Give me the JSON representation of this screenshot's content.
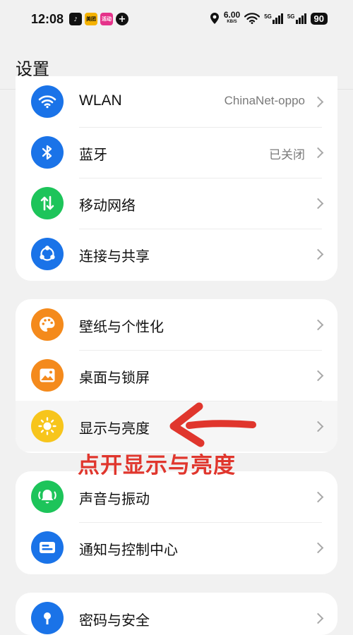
{
  "status_bar": {
    "time": "12:08",
    "app_icons": [
      {
        "name": "tiktok-icon",
        "text": "♪",
        "color": "#111111"
      },
      {
        "name": "meituan-icon",
        "text": "美团",
        "color": "#f5b200"
      },
      {
        "name": "shopping-app-icon",
        "text": "活动",
        "color": "#e5338a"
      },
      {
        "name": "plus-badge-icon",
        "text": "+",
        "color": "#111111"
      }
    ],
    "speed_value": "6.00",
    "speed_unit": "KB/S",
    "network_tag_1": "5G",
    "network_tag_2": "5G",
    "battery": "90"
  },
  "header": {
    "title": "设置"
  },
  "colors": {
    "blue": "#1a73e8",
    "green": "#1dc45a",
    "orange": "#f48a1c",
    "yellow": "#f7c51c",
    "annotation_red": "#e0362d"
  },
  "groups": [
    {
      "items": [
        {
          "label": "WLAN",
          "value": "ChinaNet-oppo",
          "icon": "wifi-icon",
          "color": "#1a73e8"
        },
        {
          "label": "蓝牙",
          "value": "已关闭",
          "icon": "bluetooth-icon",
          "color": "#1a73e8"
        },
        {
          "label": "移动网络",
          "value": "",
          "icon": "mobile-data-icon",
          "color": "#1dc45a"
        },
        {
          "label": "连接与共享",
          "value": "",
          "icon": "share-icon",
          "color": "#1a73e8"
        }
      ]
    },
    {
      "items": [
        {
          "label": "壁纸与个性化",
          "value": "",
          "icon": "palette-icon",
          "color": "#f48a1c"
        },
        {
          "label": "桌面与锁屏",
          "value": "",
          "icon": "wallpaper-icon",
          "color": "#f48a1c"
        },
        {
          "label": "显示与亮度",
          "value": "",
          "icon": "brightness-icon",
          "color": "#f7c51c"
        }
      ]
    },
    {
      "items": [
        {
          "label": "声音与振动",
          "value": "",
          "icon": "bell-icon",
          "color": "#1dc45a"
        },
        {
          "label": "通知与控制中心",
          "value": "",
          "icon": "notification-icon",
          "color": "#1a73e8"
        }
      ]
    },
    {
      "items": [
        {
          "label": "密码与安全",
          "value": "",
          "icon": "security-icon",
          "color": "#1a73e8"
        }
      ]
    }
  ],
  "annotation": {
    "text": "点开显示与亮度"
  }
}
